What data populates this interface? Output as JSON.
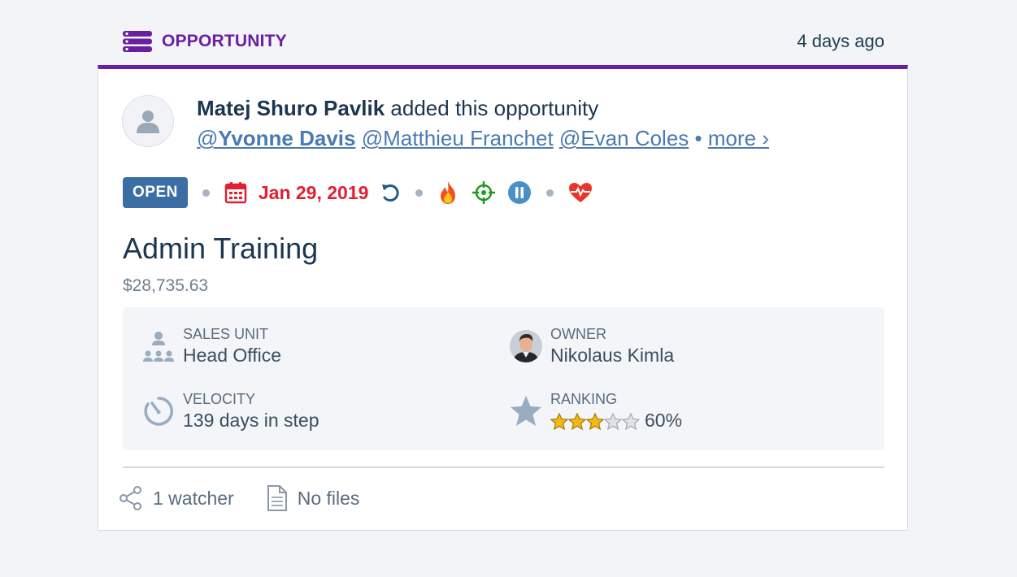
{
  "header": {
    "type_label": "OPPORTUNITY",
    "time_ago": "4 days ago",
    "accent": "#6a1fa1"
  },
  "activity": {
    "author": "Matej Shuro Pavlik",
    "verb": "added this opportunity",
    "mentions": [
      {
        "at": "@",
        "name": "Yvonne Davis"
      },
      {
        "at": "@",
        "name": "Matthieu Franchet"
      },
      {
        "at": "@",
        "name": "Evan Coles"
      }
    ],
    "more": "more ›",
    "bullet": "•"
  },
  "meta": {
    "status": "OPEN",
    "date": "Jan 29, 2019",
    "icons": [
      "calendar-icon",
      "refresh-icon",
      "fire-icon",
      "target-icon",
      "pause-icon",
      "heartbeat-icon"
    ],
    "date_color": "#e02030"
  },
  "opportunity": {
    "title": "Admin Training",
    "amount": "$28,735.63"
  },
  "fields": {
    "sales_unit": {
      "label": "SALES UNIT",
      "value": "Head Office"
    },
    "owner": {
      "label": "OWNER",
      "value": "Nikolaus Kimla"
    },
    "velocity": {
      "label": "VELOCITY",
      "value": "139 days in step"
    },
    "ranking": {
      "label": "RANKING",
      "value": "60%",
      "stars_filled": 3,
      "stars_total": 5
    }
  },
  "footer": {
    "watchers": "1 watcher",
    "files": "No files"
  }
}
